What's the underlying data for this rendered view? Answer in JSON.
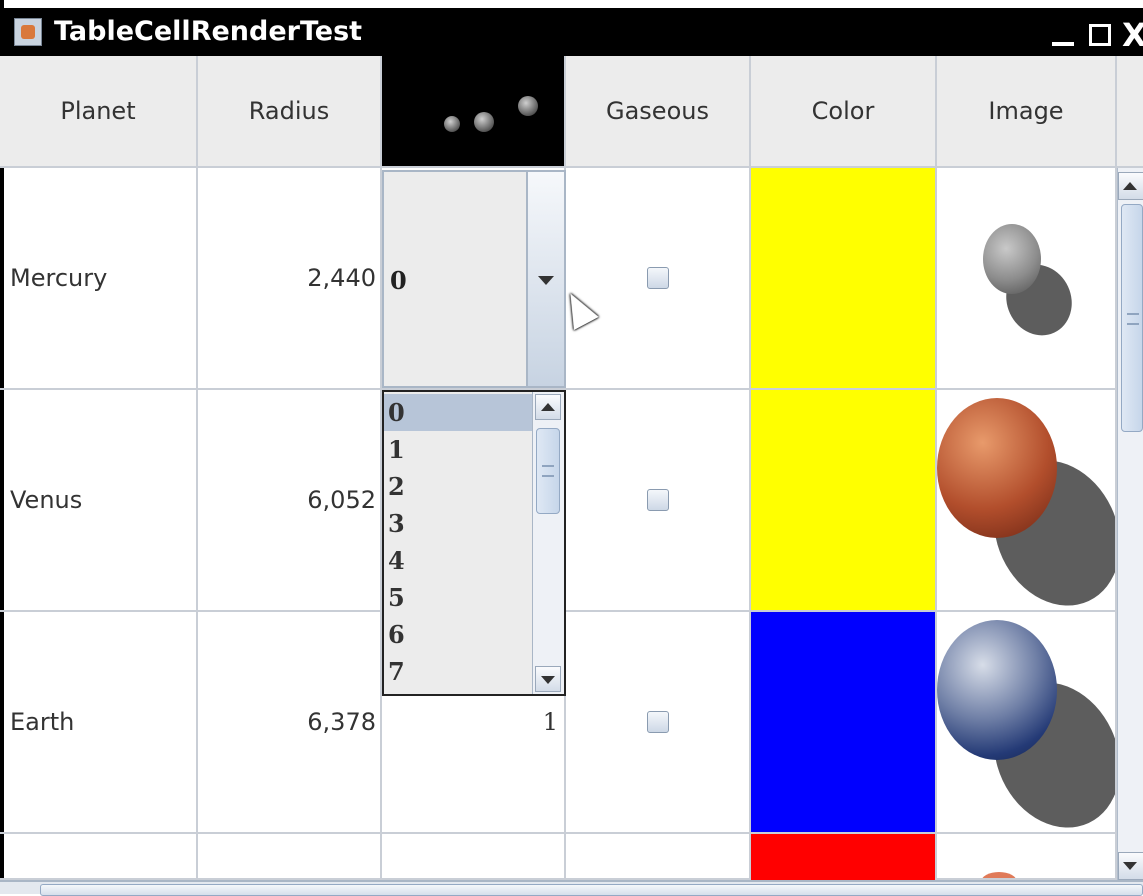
{
  "window": {
    "title": "TableCellRenderTest",
    "app_icon": "java-app-icon",
    "minimize_icon": "minimize-icon",
    "maximize_icon": "maximize-icon",
    "close_label": "X"
  },
  "table": {
    "columns": [
      {
        "label": "Planet"
      },
      {
        "label": "Radius"
      },
      {
        "label": "",
        "icon": "moons-image-header"
      },
      {
        "label": "Gaseous"
      },
      {
        "label": "Color"
      },
      {
        "label": "Image"
      }
    ],
    "rows": [
      {
        "planet": "Mercury",
        "radius": "2,440",
        "moons": "0",
        "gaseous": false,
        "color": "#ffff00",
        "image": "mercury-image"
      },
      {
        "planet": "Venus",
        "radius": "6,052",
        "moons": "",
        "gaseous": false,
        "color": "#ffff00",
        "image": "venus-image"
      },
      {
        "planet": "Earth",
        "radius": "6,378",
        "moons": "1",
        "gaseous": false,
        "color": "#0000ff",
        "image": "earth-image"
      },
      {
        "planet": "",
        "radius": "",
        "moons": "",
        "gaseous": false,
        "color": "#ff0000",
        "image": "mars-image"
      }
    ]
  },
  "combo_editor": {
    "selected_value": "0",
    "options": [
      "0",
      "1",
      "2",
      "3",
      "4",
      "5",
      "6",
      "7"
    ],
    "highlighted_index": 0
  },
  "colors": {
    "yellow": "#ffff00",
    "blue": "#0000ff",
    "red": "#ff0000"
  }
}
